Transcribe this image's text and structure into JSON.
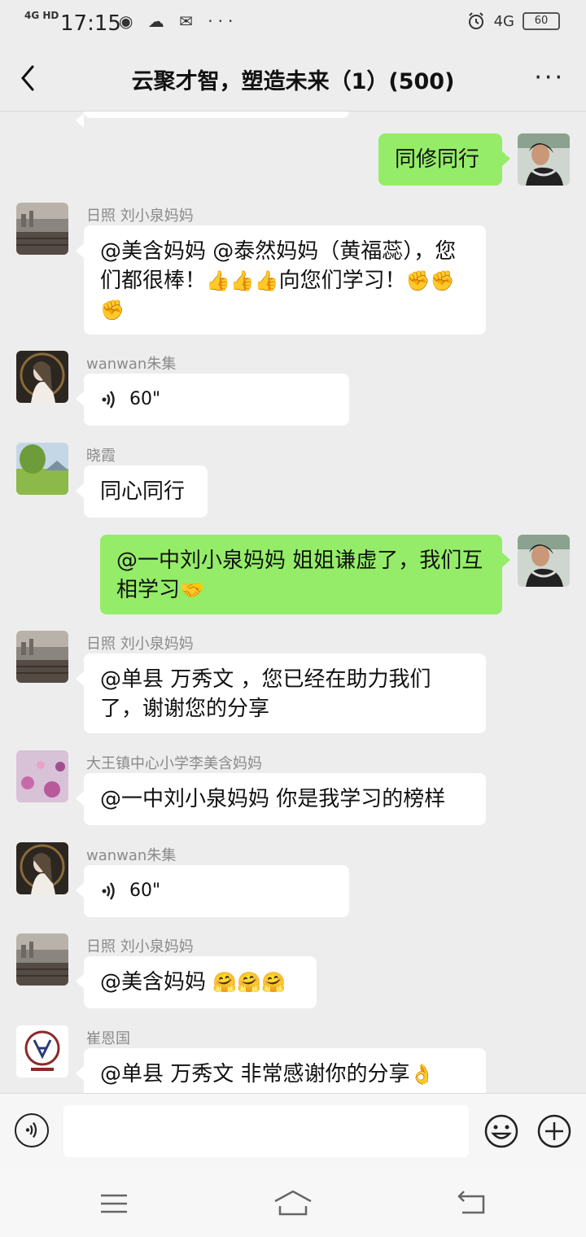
{
  "status_bar": {
    "network": "4G HD",
    "time": "17:15",
    "left_icons": "◉ ☁ ✉ ···",
    "right_network": "4G",
    "battery": "60"
  },
  "header": {
    "title": "云聚才智，塑造未来（1）(500)"
  },
  "messages": [
    {
      "side": "right",
      "text": "同修同行"
    },
    {
      "side": "left",
      "sender": "日照  刘小泉妈妈",
      "text": "@美含妈妈 @泰然妈妈（黄福蕊），您们都很棒！",
      "emoji": "👍👍👍",
      "text2": "向您们学习！",
      "emoji2": "✊✊✊"
    },
    {
      "side": "left",
      "sender": "wanwan朱集",
      "voice_duration": "60\""
    },
    {
      "side": "left",
      "sender": "晓霞",
      "text": "同心同行"
    },
    {
      "side": "right",
      "text": "@一中刘小泉妈妈  姐姐谦虚了，我们互相学习",
      "emoji": "🤝"
    },
    {
      "side": "left",
      "sender": "日照  刘小泉妈妈",
      "text": "@单县   万秀文 ，您已经在助力我们了，谢谢您的分享"
    },
    {
      "side": "left",
      "sender": "大王镇中心小学李美含妈妈",
      "text": "@一中刘小泉妈妈  你是我学习的榜样"
    },
    {
      "side": "left",
      "sender": "wanwan朱集",
      "voice_duration": "60\""
    },
    {
      "side": "left",
      "sender": "日照  刘小泉妈妈",
      "text": "@美含妈妈 ",
      "emoji": "🤗🤗🤗"
    },
    {
      "side": "left",
      "sender": "崔恩国",
      "text": "@单县   万秀文  非常感谢你的分享",
      "emoji": "👌"
    }
  ],
  "input_bar": {
    "text_value": ""
  },
  "colors": {
    "background": "#ededed",
    "my_bubble": "#95ec69",
    "other_bubble": "#ffffff"
  }
}
